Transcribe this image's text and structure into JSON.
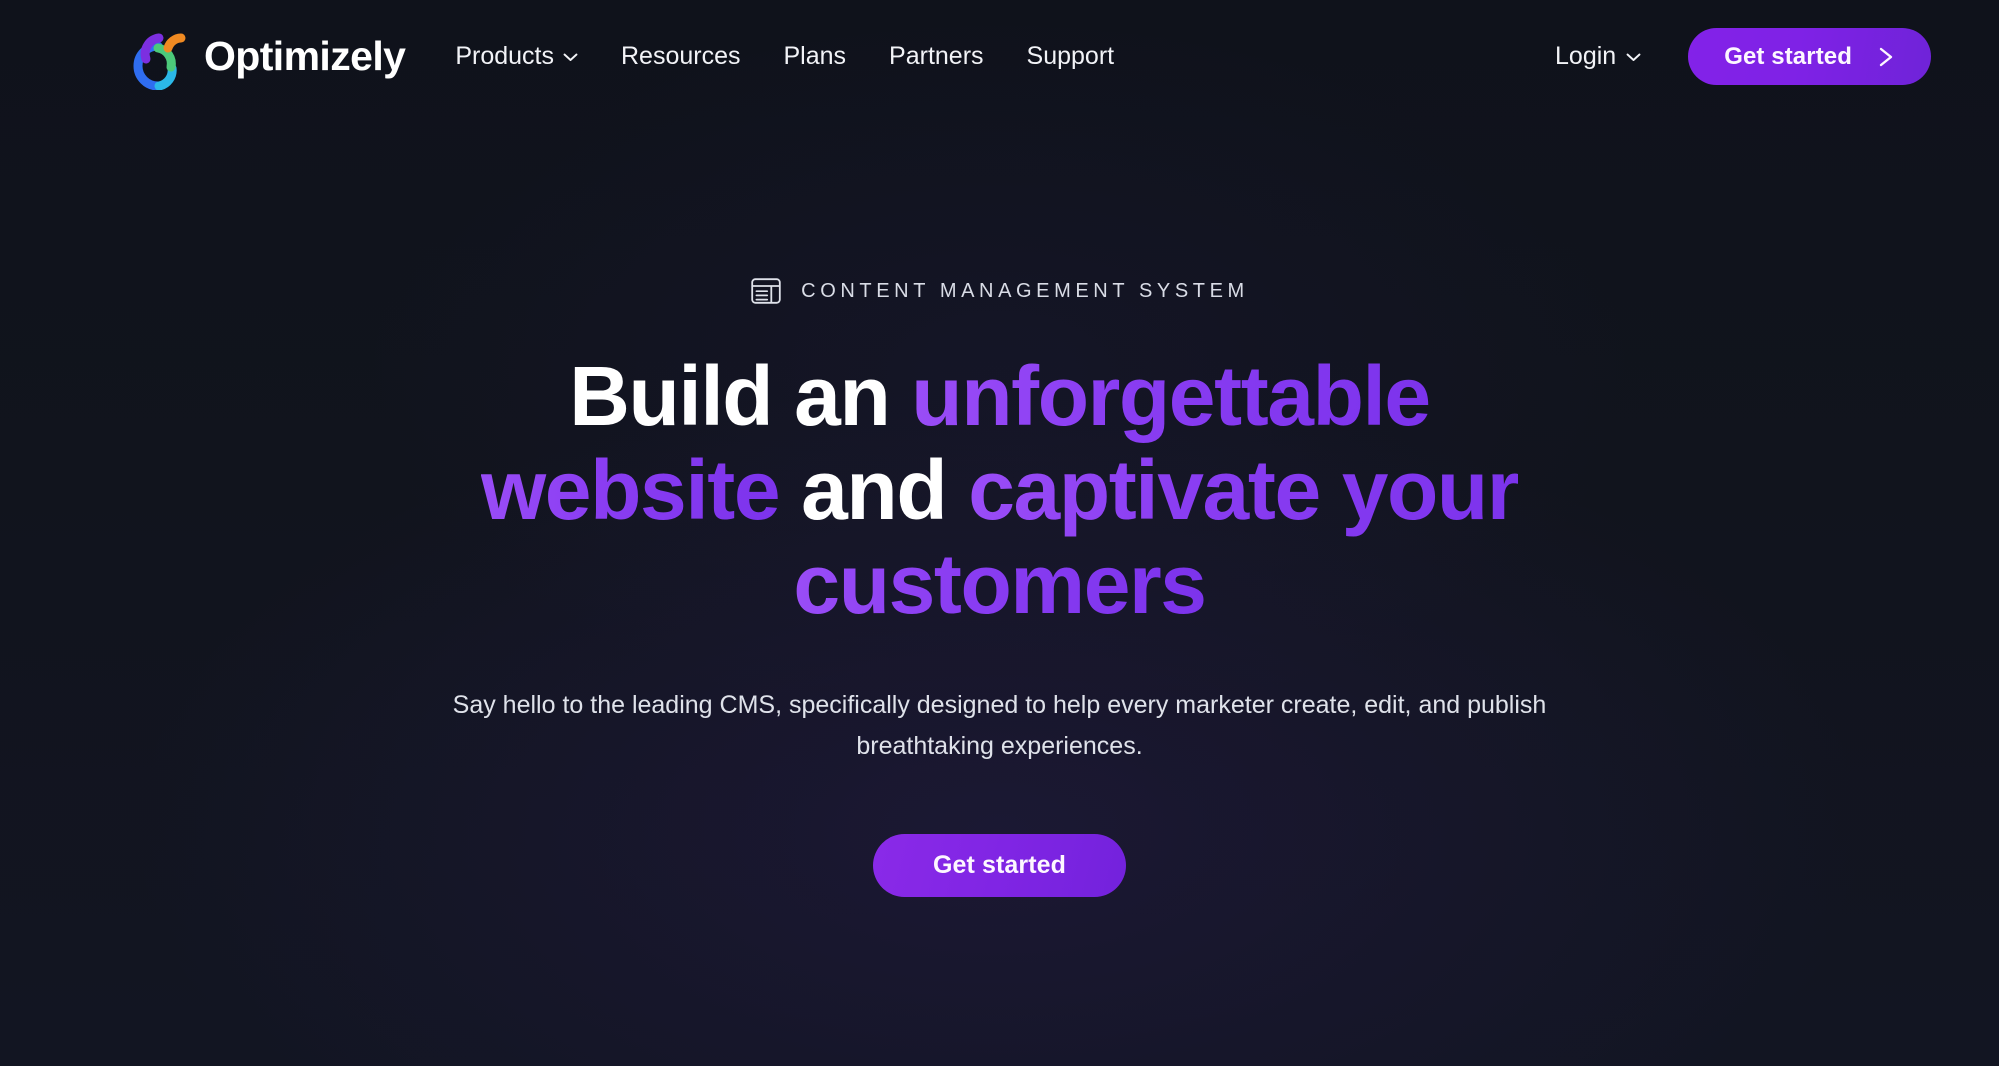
{
  "brand": {
    "name": "Optimizely",
    "logo_icon": "optimizely-logo-mark",
    "colors": {
      "arc_blue": "#2f6df0",
      "arc_purple": "#7c2fe0",
      "arc_green": "#4cc97a",
      "arc_cyan": "#2bb8e8",
      "arc_orange": "#f08a22"
    }
  },
  "nav": {
    "items": [
      {
        "label": "Products",
        "has_dropdown": true,
        "icon": "chevron-down-icon"
      },
      {
        "label": "Resources",
        "has_dropdown": false
      },
      {
        "label": "Plans",
        "has_dropdown": false
      },
      {
        "label": "Partners",
        "has_dropdown": false
      },
      {
        "label": "Support",
        "has_dropdown": false
      }
    ]
  },
  "header_actions": {
    "login_label": "Login",
    "login_icon": "chevron-down-icon",
    "cta_label": "Get started",
    "cta_icon": "chevron-right-icon",
    "cta_color": "#7f22e6"
  },
  "hero": {
    "eyebrow": {
      "icon": "cms-layout-icon",
      "text": "CONTENT MANAGEMENT SYSTEM"
    },
    "headline": {
      "line1_plain": "Build an ",
      "line1_accent": "unforgettable",
      "line2_accent_a": "website",
      "line2_plain": " and ",
      "line2_accent_b": "captivate your",
      "line3_accent": "customers",
      "accent_color": "#8a3df2"
    },
    "subtext": "Say hello to the leading CMS, specifically designed to help every marketer create, edit, and publish breathtaking experiences.",
    "cta_label": "Get started",
    "cta_color": "#8025e4"
  },
  "theme": {
    "background": "#11141d",
    "text_primary": "#ffffff",
    "text_secondary": "#dfe2ea"
  }
}
